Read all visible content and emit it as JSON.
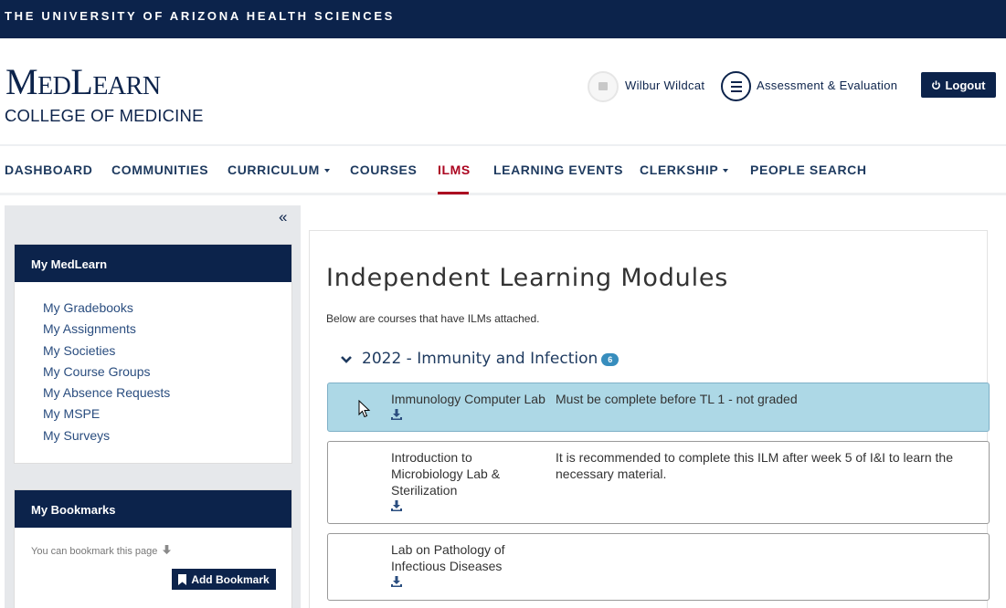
{
  "topbar": {
    "text": "THE UNIVERSITY OF ARIZONA HEALTH SCIENCES"
  },
  "header": {
    "logo_main": "MedLearn",
    "logo_sub": "COLLEGE OF MEDICINE",
    "user_name": "Wilbur Wildcat",
    "assessment_label": "Assessment & Evaluation",
    "logout_label": "Logout"
  },
  "nav": {
    "items": [
      {
        "label": "DASHBOARD"
      },
      {
        "label": "COMMUNITIES"
      },
      {
        "label": "CURRICULUM"
      },
      {
        "label": "COURSES"
      },
      {
        "label": "ILMS"
      },
      {
        "label": "LEARNING EVENTS"
      },
      {
        "label": "CLERKSHIP"
      },
      {
        "label": "PEOPLE SEARCH"
      }
    ],
    "active": "ILMS"
  },
  "sidebar": {
    "my_medlearn": {
      "title": "My MedLearn",
      "links": [
        "My Gradebooks",
        "My Assignments",
        "My Societies",
        "My Course Groups",
        "My Absence Requests",
        "My MSPE",
        "My Surveys"
      ]
    },
    "bookmarks": {
      "title": "My Bookmarks",
      "hint": "You can bookmark this page",
      "button": "Add Bookmark"
    }
  },
  "main": {
    "title": "Independent Learning Modules",
    "description": "Below are courses that have ILMs attached.",
    "course": {
      "name": "2022 - Immunity and Infection",
      "count": "6"
    },
    "ilms": [
      {
        "name": "Immunology Computer Lab",
        "description": "Must be complete before TL 1 - not graded",
        "highlighted": true
      },
      {
        "name": "Introduction to Microbiology Lab & Sterilization",
        "description": "It is recommended to complete this ILM after week 5 of I&I to learn the necessary material.",
        "highlighted": false
      },
      {
        "name": "Lab on Pathology of Infectious Diseases",
        "description": "",
        "highlighted": false
      }
    ]
  },
  "colors": {
    "navy": "#0c234b",
    "red": "#ab0520",
    "highlight": "#add8e6",
    "badge": "#378dbd"
  }
}
